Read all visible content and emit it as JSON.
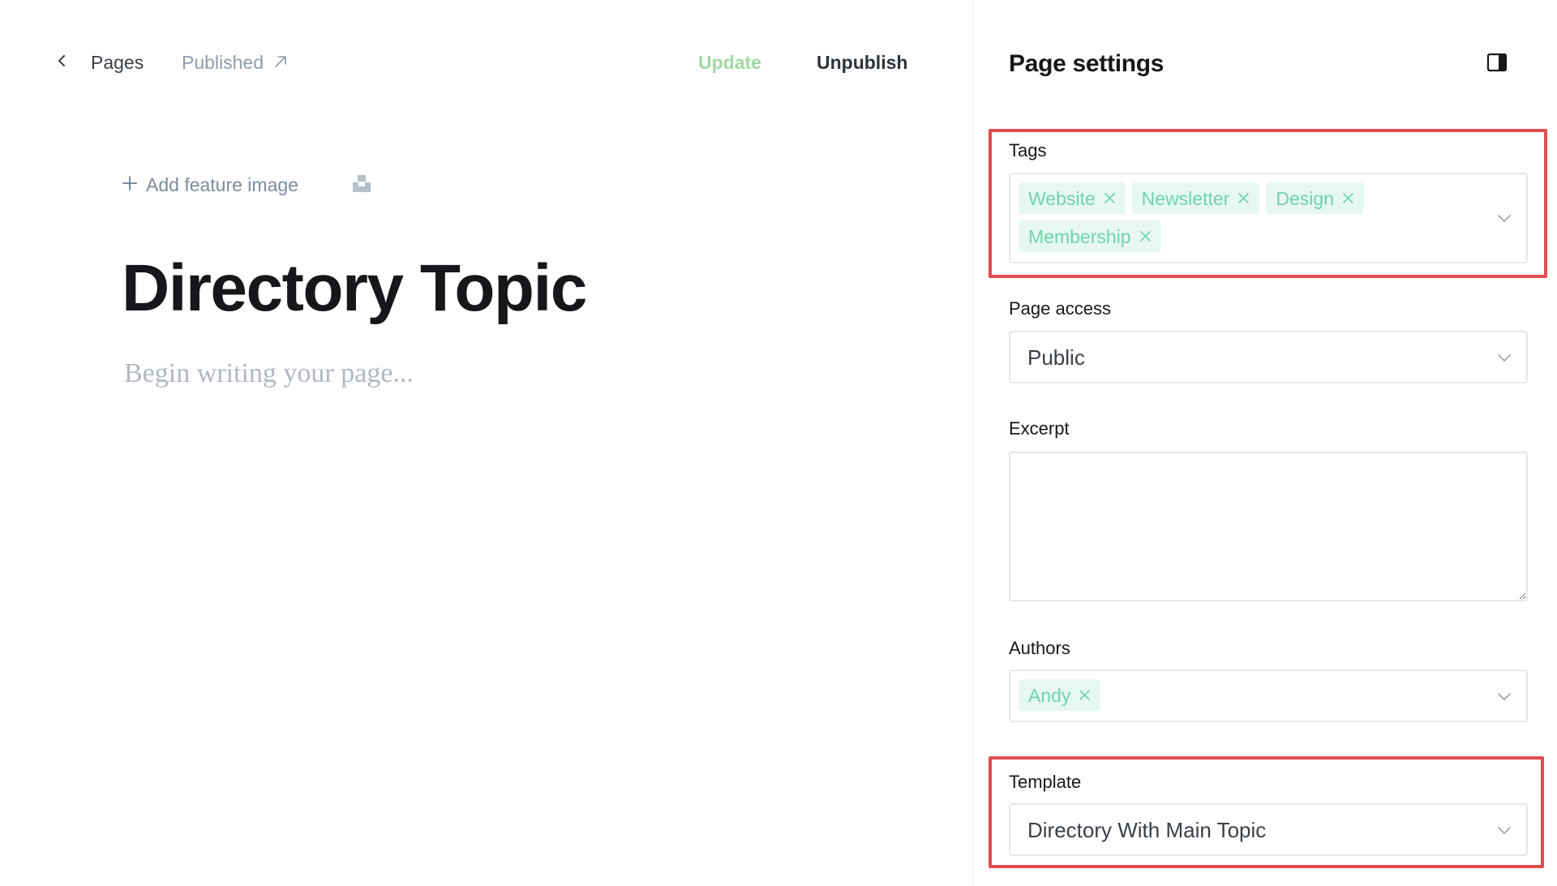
{
  "header": {
    "back_label": "Pages",
    "status_label": "Published",
    "update_label": "Update",
    "unpublish_label": "Unpublish"
  },
  "editor": {
    "add_feature_image_label": "Add feature image",
    "title": "Directory Topic",
    "body_placeholder": "Begin writing your page..."
  },
  "panel": {
    "title": "Page settings",
    "tags": {
      "label": "Tags",
      "items": [
        "Website",
        "Newsletter",
        "Design",
        "Membership"
      ]
    },
    "page_access": {
      "label": "Page access",
      "value": "Public"
    },
    "excerpt": {
      "label": "Excerpt",
      "value": ""
    },
    "authors": {
      "label": "Authors",
      "items": [
        "Andy"
      ]
    },
    "template": {
      "label": "Template",
      "value": "Directory With Main Topic"
    }
  },
  "colors": {
    "accent_green": "#a0d9a3",
    "tag_text": "#6fd4ab",
    "tag_bg": "#e7f8f2",
    "highlight_red": "#e24c50"
  }
}
